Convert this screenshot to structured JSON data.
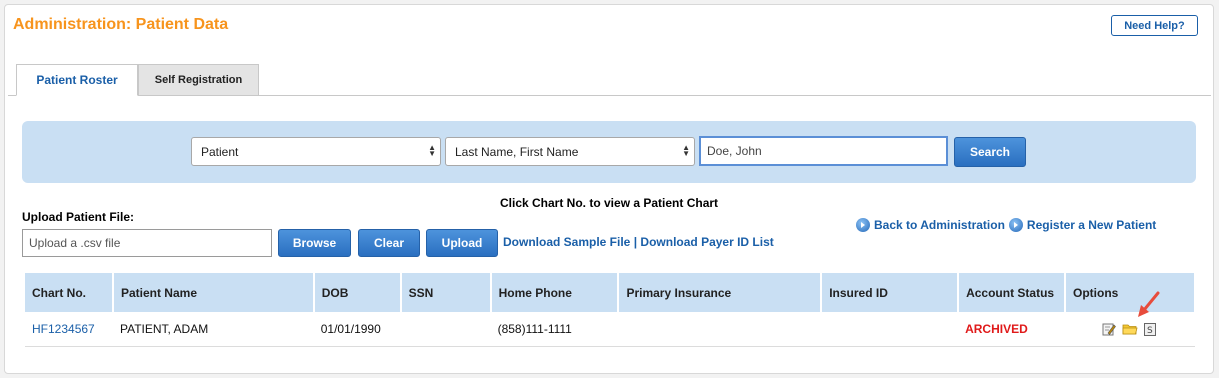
{
  "page": {
    "title": "Administration: Patient Data",
    "help_label": "Need Help?"
  },
  "tabs": [
    {
      "label": "Patient Roster",
      "active": true
    },
    {
      "label": "Self Registration",
      "active": false
    }
  ],
  "search": {
    "type_select": "Patient",
    "field_select": "Last Name, First Name",
    "query_placeholder": "Doe, John",
    "search_label": "Search"
  },
  "hint": "Click Chart No. to view a Patient Chart",
  "upload": {
    "label": "Upload Patient File:",
    "file_placeholder": "Upload a .csv file",
    "browse_label": "Browse",
    "clear_label": "Clear",
    "upload_label": "Upload",
    "download_sample": "Download Sample File",
    "separator": "|",
    "download_payer": "Download Payer ID List"
  },
  "admin_links": {
    "back": "Back to Administration",
    "register": "Register a New Patient"
  },
  "table": {
    "columns": [
      "Chart No.",
      "Patient Name",
      "DOB",
      "SSN",
      "Home Phone",
      "Primary Insurance",
      "Insured ID",
      "Account Status",
      "Options"
    ],
    "rows": [
      {
        "chart_no": "HF1234567",
        "patient_name": "PATIENT, ADAM",
        "dob": "01/01/1990",
        "ssn": "",
        "home_phone": "(858)111-1111",
        "primary_insurance": "",
        "insured_id": "",
        "account_status": "ARCHIVED",
        "options": [
          "edit-icon",
          "folder-icon",
          "statement-icon"
        ]
      }
    ]
  },
  "colors": {
    "title": "#f7941d",
    "link": "#1a5fa8",
    "header_bg": "#c9dff3",
    "archived": "#e01a1a",
    "button": "#2a6fc0"
  }
}
